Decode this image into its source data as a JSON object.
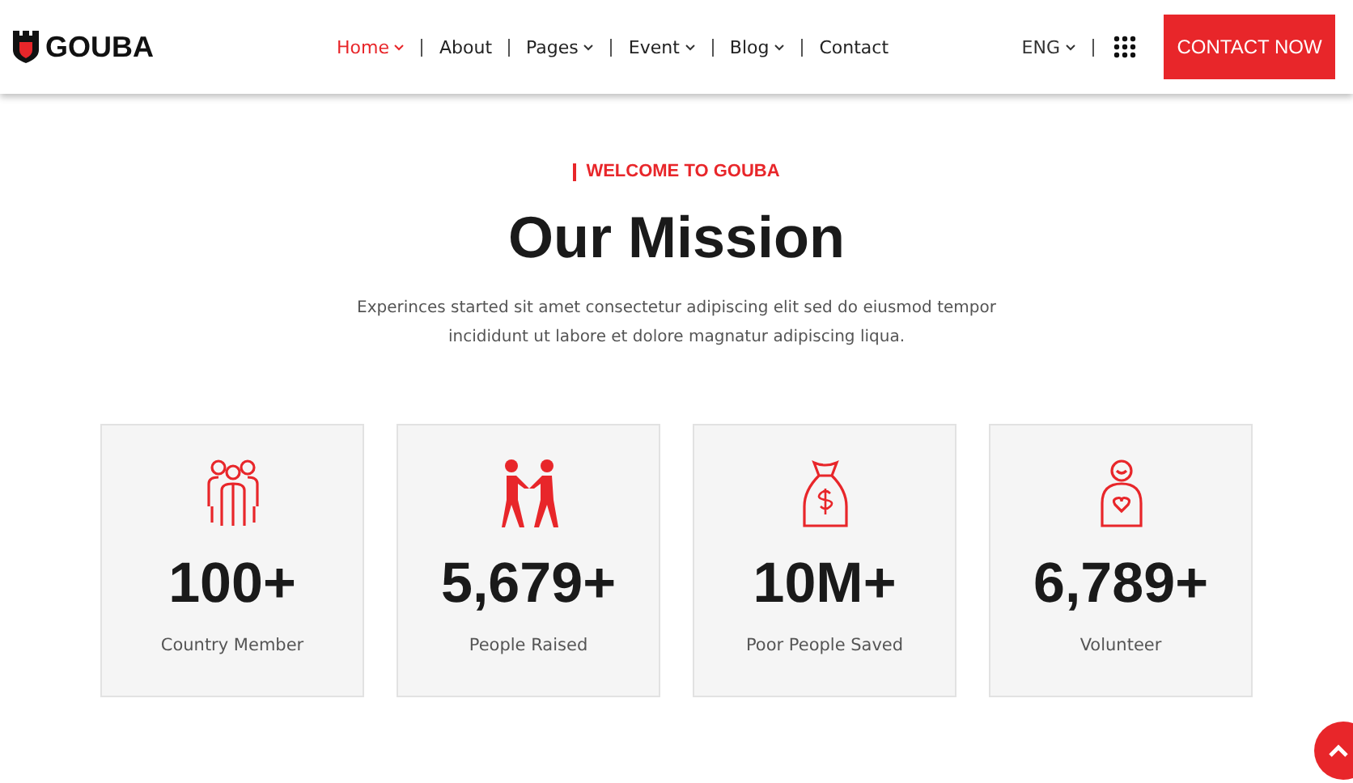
{
  "header": {
    "logo": "GOUBA",
    "nav": [
      {
        "label": "Home",
        "selected": true,
        "dropdown": true
      },
      {
        "label": "About",
        "selected": false,
        "dropdown": false
      },
      {
        "label": "Pages",
        "selected": false,
        "dropdown": true
      },
      {
        "label": "Event",
        "selected": false,
        "dropdown": true
      },
      {
        "label": "Blog",
        "selected": false,
        "dropdown": true
      },
      {
        "label": "Contact",
        "selected": false,
        "dropdown": false
      }
    ],
    "language": "ENG",
    "cta": "CONTACT NOW"
  },
  "section": {
    "eyebrow": "WELCOME TO GOUBA",
    "title": "Our Mission",
    "description": "Experinces started sit amet consectetur adipiscing elit sed do eiusmod tempor incididunt ut labore et dolore magnatur adipiscing liqua.",
    "stats": [
      {
        "kind": "group",
        "value": "100+",
        "label": "Country Member"
      },
      {
        "kind": "handshake",
        "value": "5,679+",
        "label": "People Raised"
      },
      {
        "kind": "moneybag",
        "value": "10M+",
        "label": "Poor People Saved"
      },
      {
        "kind": "volunteer",
        "value": "6,789+",
        "label": "Volunteer"
      }
    ]
  }
}
